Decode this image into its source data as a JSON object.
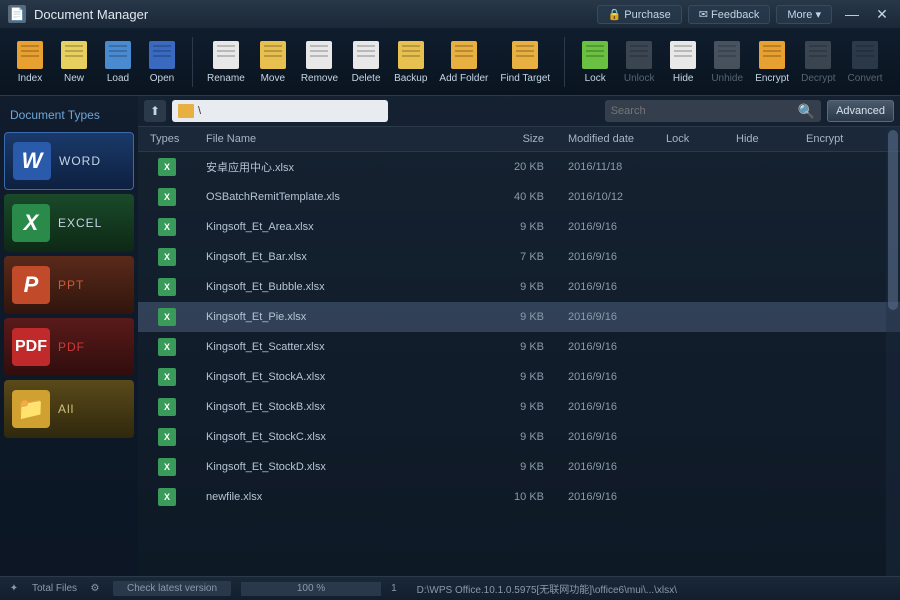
{
  "title": "Document Manager",
  "topButtons": {
    "purchase": "Purchase",
    "feedback": "Feedback",
    "more": "More ▾"
  },
  "toolbar": {
    "index": "Index",
    "new": "New",
    "load": "Load",
    "open": "Open",
    "rename": "Rename",
    "move": "Move",
    "remove": "Remove",
    "delete": "Delete",
    "backup": "Backup",
    "addfolder": "Add Folder",
    "findtarget": "Find Target",
    "lock": "Lock",
    "unlock": "Unlock",
    "hide": "Hide",
    "unhide": "Unhide",
    "encrypt": "Encrypt",
    "decrypt": "Decrypt",
    "convert": "Convert"
  },
  "sidebar": {
    "header": "Document Types",
    "items": [
      {
        "label": "WORD",
        "class": "tc-word",
        "glyph": "W"
      },
      {
        "label": "EXCEL",
        "class": "tc-excel",
        "glyph": "X"
      },
      {
        "label": "PPT",
        "class": "tc-ppt",
        "glyph": "P"
      },
      {
        "label": "PDF",
        "class": "tc-pdf",
        "glyph": "PDF"
      },
      {
        "label": "All",
        "class": "tc-all",
        "glyph": "📁"
      }
    ]
  },
  "path": "\\",
  "search": {
    "placeholder": "Search"
  },
  "advanced": "Advanced",
  "columns": {
    "types": "Types",
    "name": "File Name",
    "size": "Size",
    "mod": "Modified date",
    "lock": "Lock",
    "hide": "Hide",
    "enc": "Encrypt"
  },
  "files": [
    {
      "name": "安卓应用中心.xlsx",
      "size": "20 KB",
      "mod": "2016/11/18"
    },
    {
      "name": "OSBatchRemitTemplate.xls",
      "size": "40 KB",
      "mod": "2016/10/12"
    },
    {
      "name": "Kingsoft_Et_Area.xlsx",
      "size": "9 KB",
      "mod": "2016/9/16"
    },
    {
      "name": "Kingsoft_Et_Bar.xlsx",
      "size": "7 KB",
      "mod": "2016/9/16"
    },
    {
      "name": "Kingsoft_Et_Bubble.xlsx",
      "size": "9 KB",
      "mod": "2016/9/16"
    },
    {
      "name": "Kingsoft_Et_Pie.xlsx",
      "size": "9 KB",
      "mod": "2016/9/16",
      "selected": true
    },
    {
      "name": "Kingsoft_Et_Scatter.xlsx",
      "size": "9 KB",
      "mod": "2016/9/16"
    },
    {
      "name": "Kingsoft_Et_StockA.xlsx",
      "size": "9 KB",
      "mod": "2016/9/16"
    },
    {
      "name": "Kingsoft_Et_StockB.xlsx",
      "size": "9 KB",
      "mod": "2016/9/16"
    },
    {
      "name": "Kingsoft_Et_StockC.xlsx",
      "size": "9 KB",
      "mod": "2016/9/16"
    },
    {
      "name": "Kingsoft_Et_StockD.xlsx",
      "size": "9 KB",
      "mod": "2016/9/16"
    },
    {
      "name": "newfile.xlsx",
      "size": "10 KB",
      "mod": "2016/9/16"
    }
  ],
  "status": {
    "totalFiles": "Total Files",
    "checkVersion": "Check latest version",
    "progress": "100 %",
    "count": "1",
    "path": "D:\\WPS Office.10.1.0.5975[无联网功能]\\office6\\mui\\...\\xlsx\\"
  },
  "iconColors": {
    "index": "#e8a030",
    "new": "#e8d060",
    "load": "#4a8ad0",
    "open": "#3a6ac0",
    "rename": "#e8e8e8",
    "move": "#e8c050",
    "remove": "#e8e8e8",
    "delete": "#e8e8e8",
    "backup": "#e8c050",
    "addfolder": "#e8b040",
    "findtarget": "#e8b040",
    "lock": "#6ac040",
    "unlock": "#808890",
    "hide": "#e8e8e8",
    "unhide": "#a0a8b0",
    "encrypt": "#e8a030",
    "decrypt": "#808890",
    "convert": "#5a6a7a"
  }
}
